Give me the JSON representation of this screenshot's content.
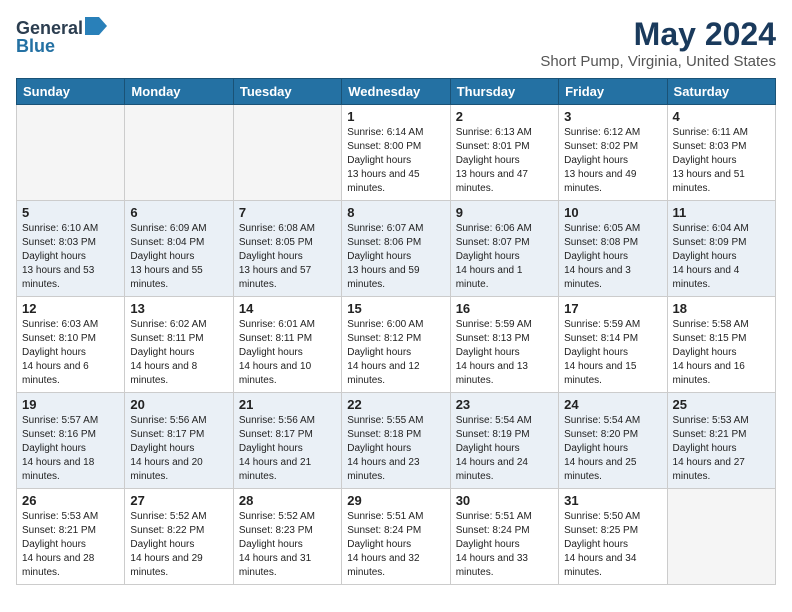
{
  "header": {
    "logo_general": "General",
    "logo_blue": "Blue",
    "title": "May 2024",
    "location": "Short Pump, Virginia, United States"
  },
  "weekdays": [
    "Sunday",
    "Monday",
    "Tuesday",
    "Wednesday",
    "Thursday",
    "Friday",
    "Saturday"
  ],
  "weeks": [
    [
      {
        "day": "",
        "empty": true
      },
      {
        "day": "",
        "empty": true
      },
      {
        "day": "",
        "empty": true
      },
      {
        "day": "1",
        "sunrise": "6:14 AM",
        "sunset": "8:00 PM",
        "daylight": "13 hours and 45 minutes."
      },
      {
        "day": "2",
        "sunrise": "6:13 AM",
        "sunset": "8:01 PM",
        "daylight": "13 hours and 47 minutes."
      },
      {
        "day": "3",
        "sunrise": "6:12 AM",
        "sunset": "8:02 PM",
        "daylight": "13 hours and 49 minutes."
      },
      {
        "day": "4",
        "sunrise": "6:11 AM",
        "sunset": "8:03 PM",
        "daylight": "13 hours and 51 minutes."
      }
    ],
    [
      {
        "day": "5",
        "sunrise": "6:10 AM",
        "sunset": "8:03 PM",
        "daylight": "13 hours and 53 minutes."
      },
      {
        "day": "6",
        "sunrise": "6:09 AM",
        "sunset": "8:04 PM",
        "daylight": "13 hours and 55 minutes."
      },
      {
        "day": "7",
        "sunrise": "6:08 AM",
        "sunset": "8:05 PM",
        "daylight": "13 hours and 57 minutes."
      },
      {
        "day": "8",
        "sunrise": "6:07 AM",
        "sunset": "8:06 PM",
        "daylight": "13 hours and 59 minutes."
      },
      {
        "day": "9",
        "sunrise": "6:06 AM",
        "sunset": "8:07 PM",
        "daylight": "14 hours and 1 minute."
      },
      {
        "day": "10",
        "sunrise": "6:05 AM",
        "sunset": "8:08 PM",
        "daylight": "14 hours and 3 minutes."
      },
      {
        "day": "11",
        "sunrise": "6:04 AM",
        "sunset": "8:09 PM",
        "daylight": "14 hours and 4 minutes."
      }
    ],
    [
      {
        "day": "12",
        "sunrise": "6:03 AM",
        "sunset": "8:10 PM",
        "daylight": "14 hours and 6 minutes."
      },
      {
        "day": "13",
        "sunrise": "6:02 AM",
        "sunset": "8:11 PM",
        "daylight": "14 hours and 8 minutes."
      },
      {
        "day": "14",
        "sunrise": "6:01 AM",
        "sunset": "8:11 PM",
        "daylight": "14 hours and 10 minutes."
      },
      {
        "day": "15",
        "sunrise": "6:00 AM",
        "sunset": "8:12 PM",
        "daylight": "14 hours and 12 minutes."
      },
      {
        "day": "16",
        "sunrise": "5:59 AM",
        "sunset": "8:13 PM",
        "daylight": "14 hours and 13 minutes."
      },
      {
        "day": "17",
        "sunrise": "5:59 AM",
        "sunset": "8:14 PM",
        "daylight": "14 hours and 15 minutes."
      },
      {
        "day": "18",
        "sunrise": "5:58 AM",
        "sunset": "8:15 PM",
        "daylight": "14 hours and 16 minutes."
      }
    ],
    [
      {
        "day": "19",
        "sunrise": "5:57 AM",
        "sunset": "8:16 PM",
        "daylight": "14 hours and 18 minutes."
      },
      {
        "day": "20",
        "sunrise": "5:56 AM",
        "sunset": "8:17 PM",
        "daylight": "14 hours and 20 minutes."
      },
      {
        "day": "21",
        "sunrise": "5:56 AM",
        "sunset": "8:17 PM",
        "daylight": "14 hours and 21 minutes."
      },
      {
        "day": "22",
        "sunrise": "5:55 AM",
        "sunset": "8:18 PM",
        "daylight": "14 hours and 23 minutes."
      },
      {
        "day": "23",
        "sunrise": "5:54 AM",
        "sunset": "8:19 PM",
        "daylight": "14 hours and 24 minutes."
      },
      {
        "day": "24",
        "sunrise": "5:54 AM",
        "sunset": "8:20 PM",
        "daylight": "14 hours and 25 minutes."
      },
      {
        "day": "25",
        "sunrise": "5:53 AM",
        "sunset": "8:21 PM",
        "daylight": "14 hours and 27 minutes."
      }
    ],
    [
      {
        "day": "26",
        "sunrise": "5:53 AM",
        "sunset": "8:21 PM",
        "daylight": "14 hours and 28 minutes."
      },
      {
        "day": "27",
        "sunrise": "5:52 AM",
        "sunset": "8:22 PM",
        "daylight": "14 hours and 29 minutes."
      },
      {
        "day": "28",
        "sunrise": "5:52 AM",
        "sunset": "8:23 PM",
        "daylight": "14 hours and 31 minutes."
      },
      {
        "day": "29",
        "sunrise": "5:51 AM",
        "sunset": "8:24 PM",
        "daylight": "14 hours and 32 minutes."
      },
      {
        "day": "30",
        "sunrise": "5:51 AM",
        "sunset": "8:24 PM",
        "daylight": "14 hours and 33 minutes."
      },
      {
        "day": "31",
        "sunrise": "5:50 AM",
        "sunset": "8:25 PM",
        "daylight": "14 hours and 34 minutes."
      },
      {
        "day": "",
        "empty": true
      }
    ]
  ],
  "labels": {
    "sunrise": "Sunrise:",
    "sunset": "Sunset:",
    "daylight": "Daylight hours"
  }
}
